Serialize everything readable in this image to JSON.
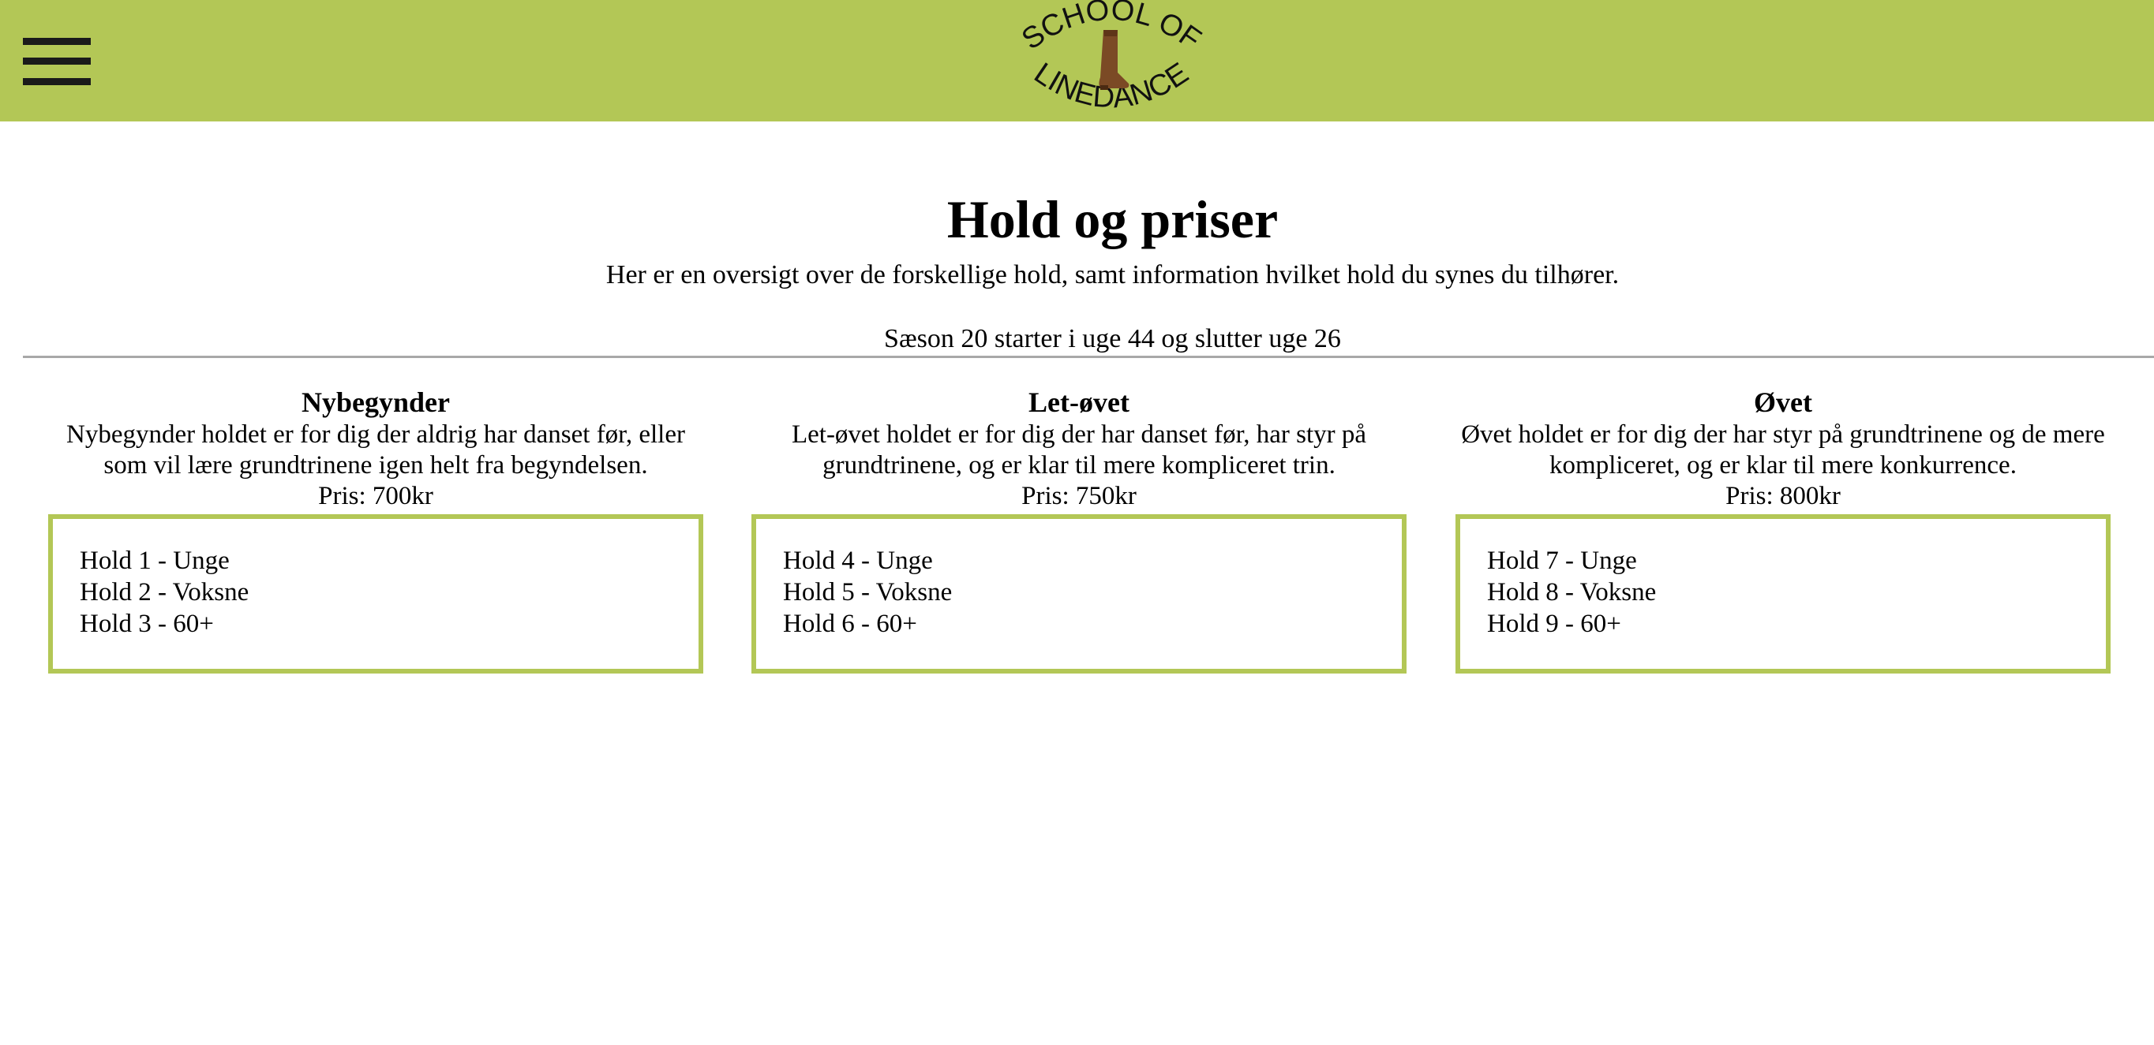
{
  "header": {
    "menu_icon": "hamburger-menu-icon",
    "logo": {
      "top_text": "SCHOOL OF",
      "bottom_text": "LINEDANCE",
      "icon": "cowboy-boot-icon"
    },
    "background_color": "#b3c756"
  },
  "main": {
    "title": "Hold og priser",
    "intro": "Her er en oversigt over de forskellige hold, samt information hvilket hold du synes du tilhører.",
    "season": "Sæson 20 starter i uge 44 og slutter uge 26"
  },
  "levels": [
    {
      "title": "Nybegynder",
      "description": "Nybegynder holdet er for dig der aldrig har danset før, eller som vil lære grundtrinene igen helt fra begyndelsen.",
      "price": "Pris: 700kr",
      "teams": [
        "Hold 1 - Unge",
        "Hold 2 - Voksne",
        "Hold 3 - 60+"
      ]
    },
    {
      "title": "Let-øvet",
      "description": "Let-øvet holdet er for dig der har danset før, har styr på grundtrinene, og er klar til mere kompliceret trin.",
      "price": "Pris: 750kr",
      "teams": [
        "Hold 4 - Unge",
        "Hold 5 - Voksne",
        "Hold 6 - 60+"
      ]
    },
    {
      "title": "Øvet",
      "description": "Øvet holdet er for dig der har styr på grundtrinene og de mere kompliceret, og er klar til mere konkurrence.",
      "price": "Pris: 800kr",
      "teams": [
        "Hold 7 - Unge",
        "Hold 8 - Voksne",
        "Hold 9 - 60+"
      ]
    }
  ],
  "accent_color": "#b3c756"
}
